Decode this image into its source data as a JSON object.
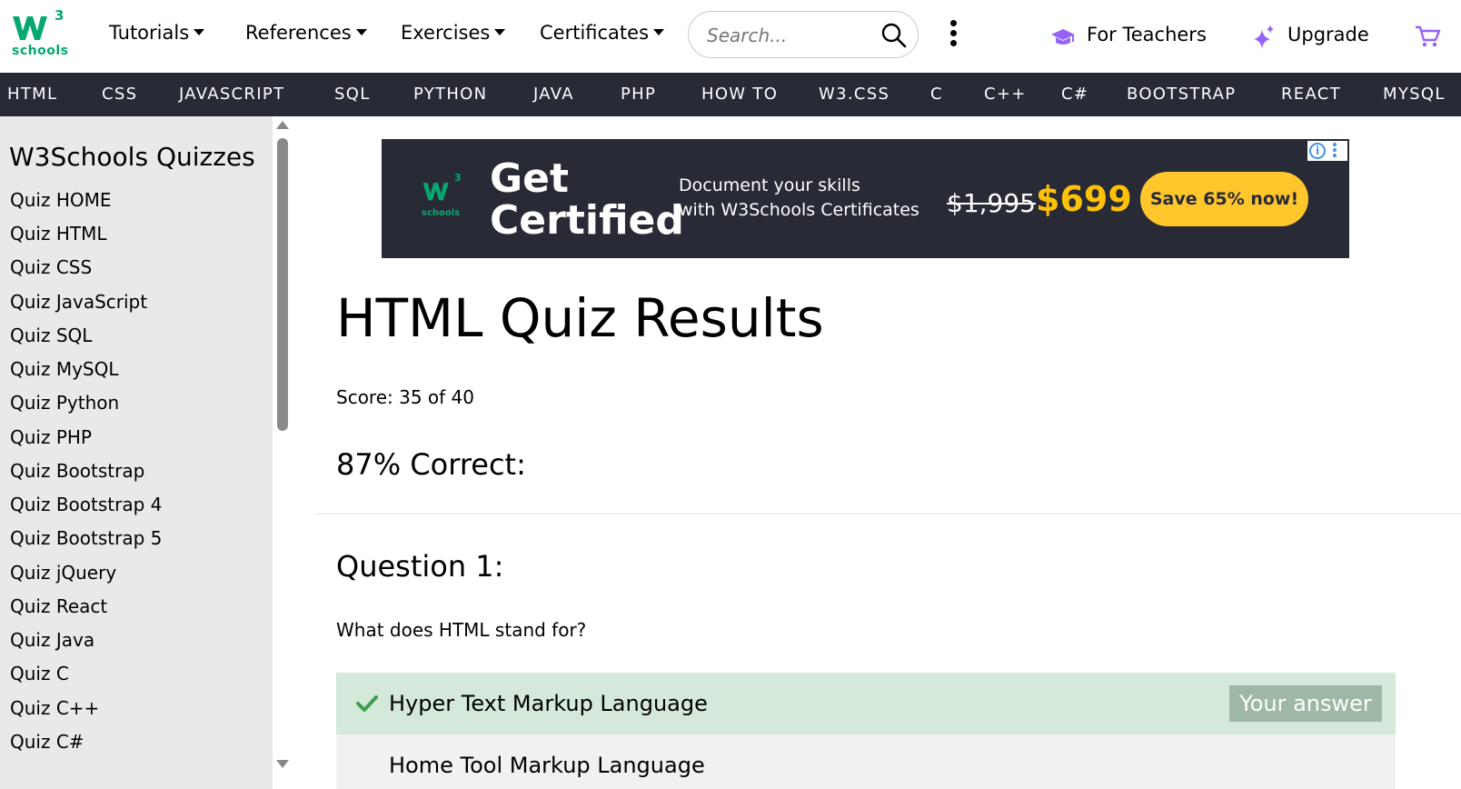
{
  "header": {
    "logo_text": "w3",
    "logo_sup": "3",
    "logo_sub": "schools",
    "nav": [
      {
        "label": "Tutorials"
      },
      {
        "label": "References"
      },
      {
        "label": "Exercises"
      },
      {
        "label": "Certificates"
      }
    ],
    "search_placeholder": "Search...",
    "for_teachers": "For Teachers",
    "upgrade": "Upgrade",
    "accent_color": "#04aa6d",
    "purple_icon_color": "#9763f6"
  },
  "subnav": {
    "items": [
      "HTML",
      "CSS",
      "JAVASCRIPT",
      "SQL",
      "PYTHON",
      "JAVA",
      "PHP",
      "HOW TO",
      "W3.CSS",
      "C",
      "C++",
      "C#",
      "BOOTSTRAP",
      "REACT",
      "MYSQL"
    ],
    "background": "#282a35"
  },
  "sidebar": {
    "title": "W3Schools Quizzes",
    "items": [
      "Quiz HOME",
      "Quiz HTML",
      "Quiz CSS",
      "Quiz JavaScript",
      "Quiz SQL",
      "Quiz MySQL",
      "Quiz Python",
      "Quiz PHP",
      "Quiz Bootstrap",
      "Quiz Bootstrap 4",
      "Quiz Bootstrap 5",
      "Quiz jQuery",
      "Quiz React",
      "Quiz Java",
      "Quiz C",
      "Quiz C++",
      "Quiz C#"
    ]
  },
  "ad": {
    "logo_text": "w3",
    "logo_sup": "3",
    "logo_sub": "schools",
    "headline_1": "Get",
    "headline_2": "Certified",
    "line_1": "Document your skills",
    "line_2": "with W3Schools Certificates",
    "old_price": "$1,995",
    "new_price": "$699",
    "cta": "Save 65% now!",
    "info_icon": "i"
  },
  "main": {
    "title": "HTML Quiz Results",
    "score": "Score: 35 of 40",
    "percent": "87% Correct:",
    "question_heading": "Question 1:",
    "question_text": "What does HTML stand for?",
    "answers": [
      {
        "text": "Hyper Text Markup Language",
        "status": "correct",
        "badge": "Your answer"
      },
      {
        "text": "Home Tool Markup Language",
        "status": "other"
      }
    ]
  }
}
